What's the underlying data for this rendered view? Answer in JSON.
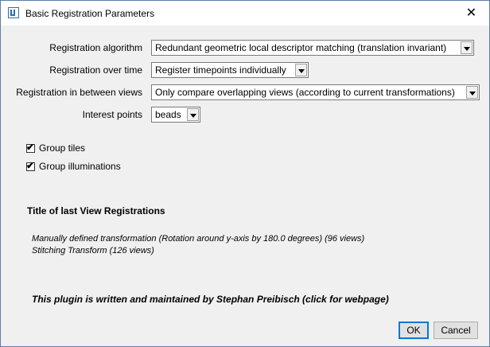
{
  "window": {
    "title": "Basic Registration Parameters",
    "close_glyph": "✕"
  },
  "form": {
    "algorithm": {
      "label": "Registration algorithm",
      "value": "Redundant geometric local descriptor matching (translation invariant)"
    },
    "over_time": {
      "label": "Registration over time",
      "value": "Register timepoints individually"
    },
    "between_views": {
      "label": "Registration in between views",
      "value": "Only compare overlapping views (according to current transformations)"
    },
    "interest_points": {
      "label": "Interest points",
      "value": "beads"
    }
  },
  "checkboxes": [
    {
      "label": "Group tiles",
      "checked": true
    },
    {
      "label": "Group illuminations",
      "checked": true
    }
  ],
  "last_registrations": {
    "heading": "Title of last View Registrations",
    "items": [
      "Manually defined transformation (Rotation around y-axis by 180.0 degrees) (96 views)",
      "Stitching Transform (126 views)"
    ]
  },
  "plugin_note": "This plugin is written and maintained by Stephan Preibisch (click for webpage)",
  "buttons": {
    "ok": "OK",
    "cancel": "Cancel"
  },
  "check_glyph": "✔"
}
